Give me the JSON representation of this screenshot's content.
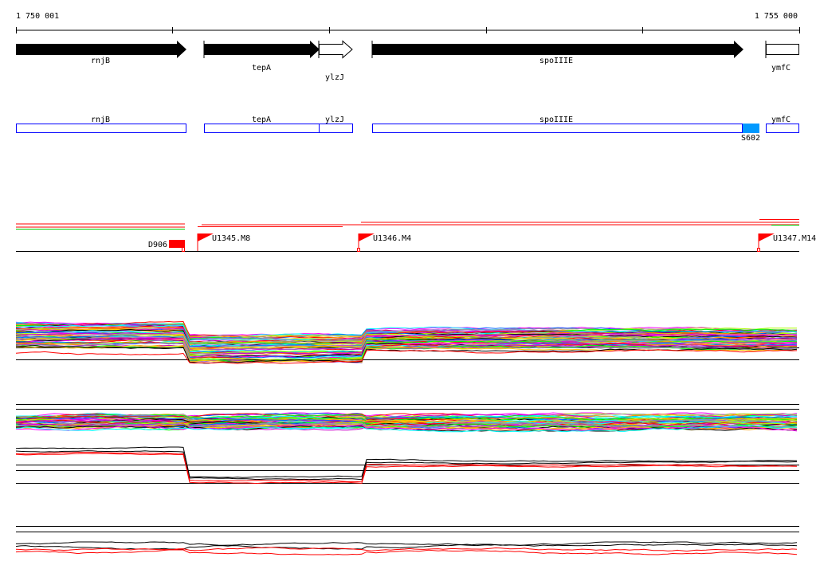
{
  "ruler": {
    "start_label": "1 750 001",
    "end_label": "1 755 000"
  },
  "genes": [
    {
      "name": "rnjB",
      "style": "filled"
    },
    {
      "name": "tepA",
      "style": "filled"
    },
    {
      "name": "ylzJ",
      "style": "open"
    },
    {
      "name": "spoIIIE",
      "style": "filled"
    },
    {
      "name": "ymfC",
      "style": "open"
    }
  ],
  "transcripts": [
    {
      "name": "rnjB"
    },
    {
      "name": "tepA"
    },
    {
      "name": "ylzJ"
    },
    {
      "name": "spoIIIE"
    },
    {
      "name": "ymfC"
    }
  ],
  "highlight_feature": {
    "name": "S602",
    "color": "#0099ff"
  },
  "markers": [
    {
      "label": "D906",
      "type": "block"
    },
    {
      "label": "U1345.M8",
      "type": "flag"
    },
    {
      "label": "U1346.M4",
      "type": "flag"
    },
    {
      "label": "U1347.M14",
      "type": "flag"
    }
  ],
  "colors": {
    "gene_fill": "#000000",
    "transcript_outline": "#0000ff",
    "marker": "#ff0000",
    "segment_green": "#00cc00",
    "trace_palette": [
      "#ff00ff",
      "#00ffff",
      "#0066ff",
      "#ff0000",
      "#aaff00",
      "#999999",
      "#ff9900",
      "#cc00cc",
      "#00ff00",
      "#9966cc",
      "#ffcc00",
      "#000000"
    ]
  }
}
